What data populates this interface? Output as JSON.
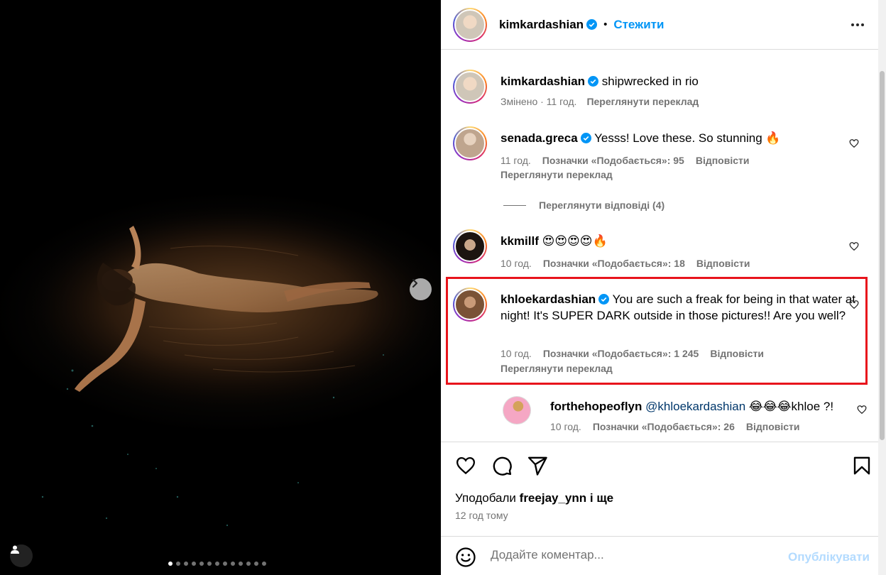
{
  "post": {
    "author": "kimkardashian",
    "follow_label": "Стежити",
    "separator": "•",
    "caption": {
      "username": "kimkardashian",
      "text": "shipwrecked in rio",
      "edited": "Змінено · 11 год.",
      "translate": "Переглянути переклад"
    },
    "image_dots": 13,
    "active_dot": 0
  },
  "comments": [
    {
      "username": "senada.greca",
      "verified": true,
      "text": "Yesss! Love these. So stunning 🔥",
      "time": "11 год.",
      "likes": "Позначки «Подобається»: 95",
      "reply": "Відповісти",
      "translate": "Переглянути переклад"
    },
    {
      "username": "kkmillf",
      "verified": false,
      "text": "😍😍😍😍🔥",
      "time": "10 год.",
      "likes": "Позначки «Подобається»: 18",
      "reply": "Відповісти"
    },
    {
      "username": "khloekardashian",
      "verified": true,
      "text": "You are such a freak for being in that water at night! It's SUPER DARK outside in those pictures!! Are you well?",
      "time": "10 год.",
      "likes": "Позначки «Подобається»: 1 245",
      "reply": "Відповісти",
      "translate": "Переглянути переклад"
    }
  ],
  "view_replies": "Переглянути відповіді (4)",
  "reply": {
    "username": "forthehopeoflyn",
    "mention": "@khloekardashian",
    "text": " 😂😂😂khloe ?!",
    "time": "10 год.",
    "likes": "Позначки «Подобається»: 26",
    "reply": "Відповісти"
  },
  "footer": {
    "liked_by_prefix": "Уподобали",
    "liked_by_user": "freejay_ynn",
    "liked_by_suffix": "і ще",
    "time_ago": "12 год тому",
    "comment_placeholder": "Додайте коментар...",
    "publish_label": "Опублікувати"
  },
  "colors": {
    "accent": "#0095f6",
    "publish_disabled": "#b3dbff",
    "highlight": "#e8141c",
    "muted": "#737373"
  },
  "icons": [
    "chevron-right-icon",
    "user-tag-icon",
    "more-icon",
    "verified-icon",
    "heart-icon",
    "comment-icon",
    "share-icon",
    "bookmark-icon",
    "emoji-icon"
  ]
}
